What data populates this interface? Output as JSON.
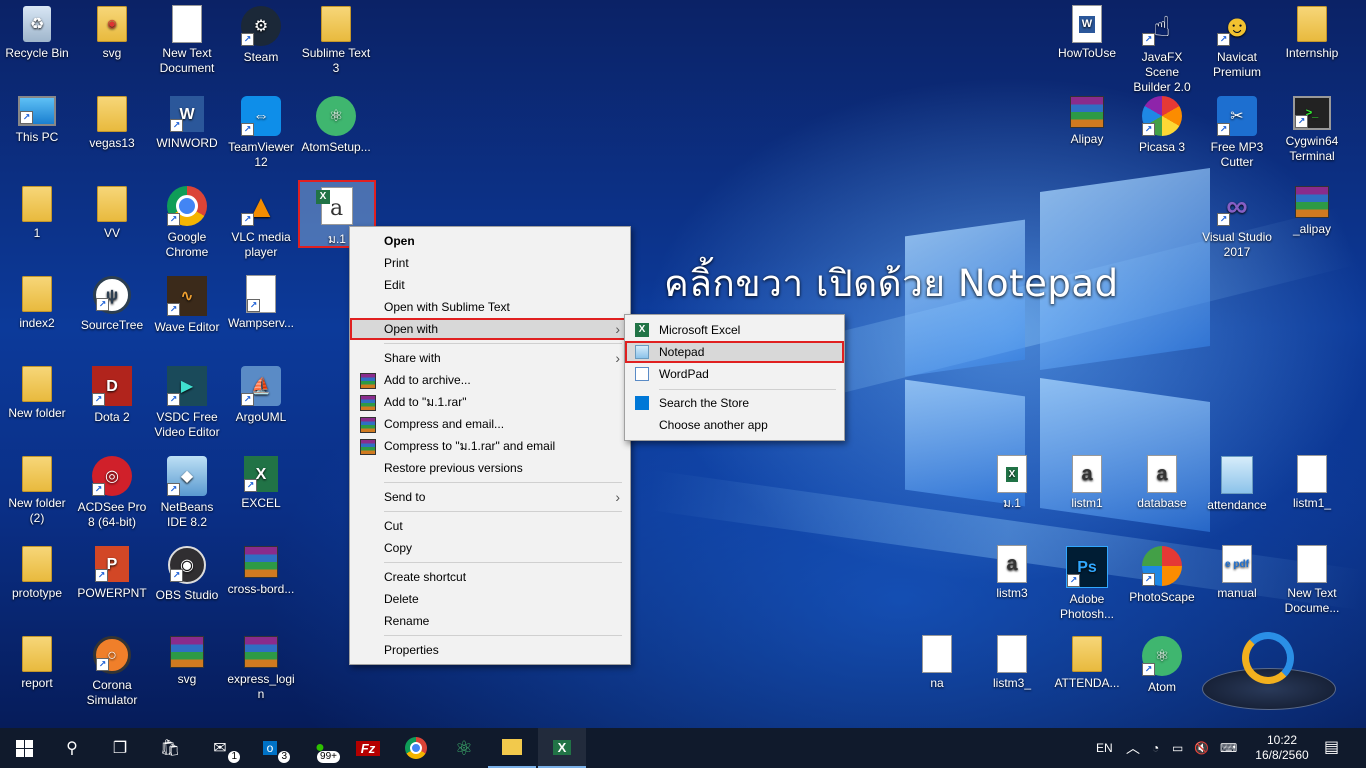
{
  "desktop": {
    "overlay_text": "คลิ้กขวา เปิดด้วย Notepad",
    "selected_file_label": "ม.1",
    "left_icons": [
      {
        "label": "Recycle Bin",
        "icon": "recycle-bin-icon"
      },
      {
        "label": "svg",
        "icon": "chrome-folder-icon"
      },
      {
        "label": "New Text Document",
        "icon": "text-document-icon"
      },
      {
        "label": "Steam",
        "icon": "steam-icon"
      },
      {
        "label": "Sublime Text 3",
        "icon": "folder-icon"
      },
      {
        "label": "This PC",
        "icon": "computer-icon"
      },
      {
        "label": "vegas13",
        "icon": "folder-icon"
      },
      {
        "label": "WINWORD",
        "icon": "word-icon"
      },
      {
        "label": "TeamViewer 12",
        "icon": "teamviewer-icon"
      },
      {
        "label": "AtomSetup...",
        "icon": "atom-icon"
      },
      {
        "label": "1",
        "icon": "folder-icon"
      },
      {
        "label": "VV",
        "icon": "folder-icon"
      },
      {
        "label": "Google Chrome",
        "icon": "chrome-icon"
      },
      {
        "label": "VLC media player",
        "icon": "vlc-icon"
      },
      {
        "label": "index2",
        "icon": "folder-icon"
      },
      {
        "label": "SourceTree",
        "icon": "sourcetree-icon"
      },
      {
        "label": "Wave Editor",
        "icon": "wave-editor-icon"
      },
      {
        "label": "Wampserv...",
        "icon": "document-icon"
      },
      {
        "label": "New folder",
        "icon": "folder-icon"
      },
      {
        "label": "Dota 2",
        "icon": "dota-icon"
      },
      {
        "label": "VSDC Free Video Editor",
        "icon": "vsdc-icon"
      },
      {
        "label": "ArgoUML",
        "icon": "argouml-icon"
      },
      {
        "label": "New folder (2)",
        "icon": "folder-icon"
      },
      {
        "label": "ACDSee Pro 8 (64-bit)",
        "icon": "acdsee-icon"
      },
      {
        "label": "NetBeans IDE 8.2",
        "icon": "netbeans-icon"
      },
      {
        "label": "EXCEL",
        "icon": "excel-icon"
      },
      {
        "label": "prototype",
        "icon": "folder-icon"
      },
      {
        "label": "POWERPNT",
        "icon": "powerpoint-icon"
      },
      {
        "label": "OBS Studio",
        "icon": "obs-icon"
      },
      {
        "label": "cross-bord...",
        "icon": "winrar-icon"
      },
      {
        "label": "report",
        "icon": "folder-icon"
      },
      {
        "label": "Corona Simulator",
        "icon": "corona-icon"
      },
      {
        "label": "svg",
        "icon": "winrar-icon"
      },
      {
        "label": "express_login",
        "icon": "winrar-icon"
      }
    ],
    "right_icons": [
      {
        "label": "HowToUse",
        "icon": "word-doc-icon"
      },
      {
        "label": "JavaFX Scene Builder 2.0",
        "icon": "scene-builder-icon"
      },
      {
        "label": "Navicat Premium",
        "icon": "navicat-icon"
      },
      {
        "label": "Internship",
        "icon": "folder-icon"
      },
      {
        "label": "Alipay",
        "icon": "winrar-icon"
      },
      {
        "label": "Picasa 3",
        "icon": "picasa-icon"
      },
      {
        "label": "Free MP3 Cutter",
        "icon": "mp3-cutter-icon"
      },
      {
        "label": "Cygwin64 Terminal",
        "icon": "terminal-icon"
      },
      {
        "label": "Visual Studio 2017",
        "icon": "visual-studio-icon"
      },
      {
        "label": "_alipay",
        "icon": "winrar-icon"
      },
      {
        "label": "ม.1",
        "icon": "excel-file-icon"
      },
      {
        "label": "listm1",
        "icon": "excel-file-icon"
      },
      {
        "label": "database",
        "icon": "excel-file-icon"
      },
      {
        "label": "attendance",
        "icon": "notepad-file-icon"
      },
      {
        "label": "listm1_",
        "icon": "text-document-icon"
      },
      {
        "label": "listm3",
        "icon": "excel-file-icon"
      },
      {
        "label": "Adobe Photosh...",
        "icon": "photoshop-icon"
      },
      {
        "label": "PhotoScape",
        "icon": "photoscape-icon"
      },
      {
        "label": "manual",
        "icon": "pdf-icon"
      },
      {
        "label": "New Text Docume...",
        "icon": "text-document-icon"
      },
      {
        "label": "na",
        "icon": "text-document-icon"
      },
      {
        "label": "listm3_",
        "icon": "text-document-icon"
      },
      {
        "label": "ATTENDA...",
        "icon": "folder-icon"
      },
      {
        "label": "Atom",
        "icon": "atom-icon"
      }
    ]
  },
  "context_menu": {
    "items": [
      {
        "label": "Open"
      },
      {
        "label": "Print"
      },
      {
        "label": "Edit"
      },
      {
        "label": "Open with Sublime Text"
      },
      {
        "label": "Open with"
      },
      {
        "label": "Share with"
      },
      {
        "label": "Add to archive..."
      },
      {
        "label": "Add to \"ม.1.rar\""
      },
      {
        "label": "Compress and email..."
      },
      {
        "label": "Compress to \"ม.1.rar\" and email"
      },
      {
        "label": "Restore previous versions"
      },
      {
        "label": "Send to"
      },
      {
        "label": "Cut"
      },
      {
        "label": "Copy"
      },
      {
        "label": "Create shortcut"
      },
      {
        "label": "Delete"
      },
      {
        "label": "Rename"
      },
      {
        "label": "Properties"
      }
    ]
  },
  "open_with_submenu": {
    "items": [
      {
        "label": "Microsoft Excel"
      },
      {
        "label": "Notepad"
      },
      {
        "label": "WordPad"
      },
      {
        "label": "Search the Store"
      },
      {
        "label": "Choose another app"
      }
    ]
  },
  "taskbar": {
    "mail_badge": "1",
    "outlook_badge": "3",
    "chat_badge": "99+",
    "language": "EN",
    "time": "10:22",
    "date": "16/8/2560"
  }
}
